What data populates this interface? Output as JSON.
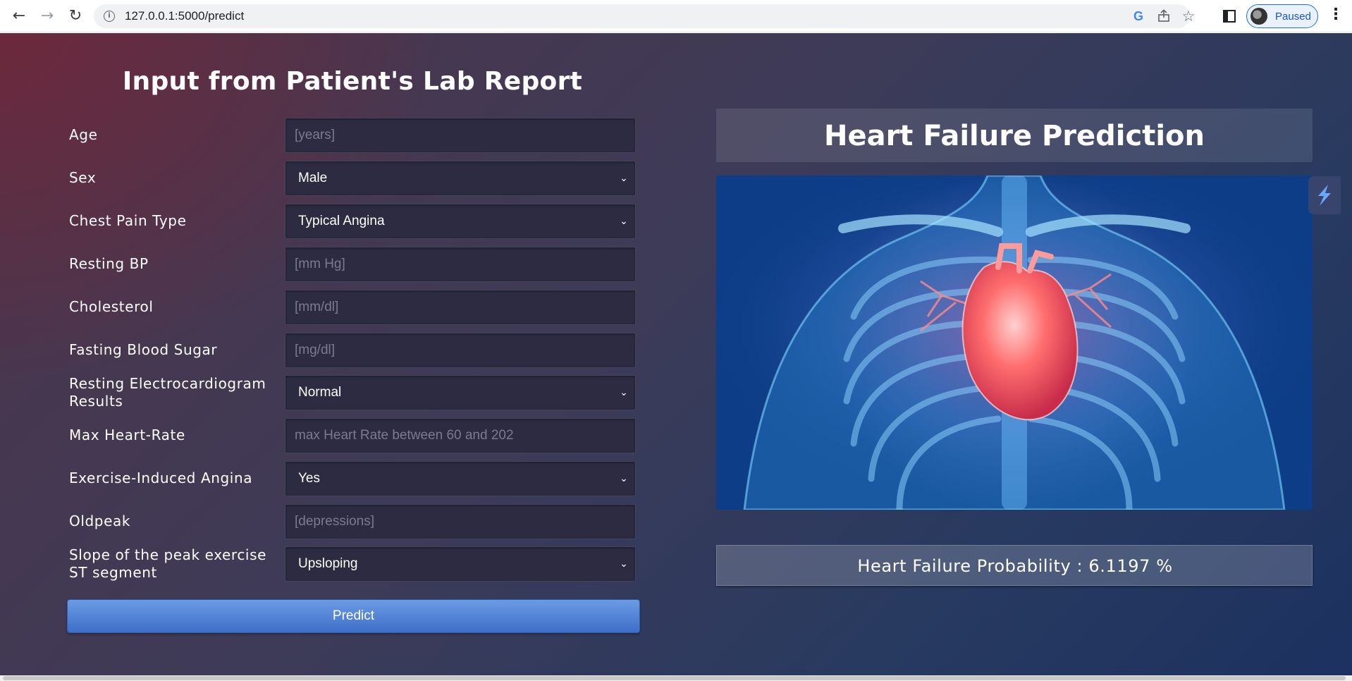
{
  "browser": {
    "url": "127.0.0.1:5000/predict",
    "profile_status": "Paused",
    "back_icon": "arrow-left-icon",
    "forward_icon": "arrow-right-icon",
    "reload_icon": "reload-icon",
    "google_icon_glyph": "G",
    "menu_glyph": "⋮"
  },
  "form": {
    "title": "Input from Patient's Lab Report",
    "fields": [
      {
        "label": "Age",
        "type": "input",
        "value": "",
        "placeholder": "[years]"
      },
      {
        "label": "Sex",
        "type": "select",
        "value": "Male"
      },
      {
        "label": "Chest Pain Type",
        "type": "select",
        "value": "Typical Angina"
      },
      {
        "label": "Resting BP",
        "type": "input",
        "value": "",
        "placeholder": "[mm Hg]"
      },
      {
        "label": "Cholesterol",
        "type": "input",
        "value": "",
        "placeholder": "[mm/dl]"
      },
      {
        "label": "Fasting Blood Sugar",
        "type": "input",
        "value": "",
        "placeholder": "[mg/dl]"
      },
      {
        "label": "Resting Electrocardiogram Results",
        "type": "select",
        "value": "Normal"
      },
      {
        "label": "Max Heart-Rate",
        "type": "input",
        "value": "",
        "placeholder": "max Heart Rate between 60 and 202"
      },
      {
        "label": "Exercise-Induced Angina",
        "type": "select",
        "value": "Yes"
      },
      {
        "label": "Oldpeak",
        "type": "input",
        "value": "",
        "placeholder": "[depressions]"
      },
      {
        "label": "Slope of the peak exercise ST segment",
        "type": "select",
        "value": "Upsloping"
      }
    ],
    "submit_label": "Predict"
  },
  "result": {
    "title": "Heart Failure Prediction",
    "image_subject": "heart-xray-illustration",
    "probability_text": "Heart Failure Probability : 6.1197 %"
  },
  "colors": {
    "accent_button": "#4a7fd6",
    "field_bg": "#2c2b42",
    "profile_chip": "#1a73e8"
  }
}
